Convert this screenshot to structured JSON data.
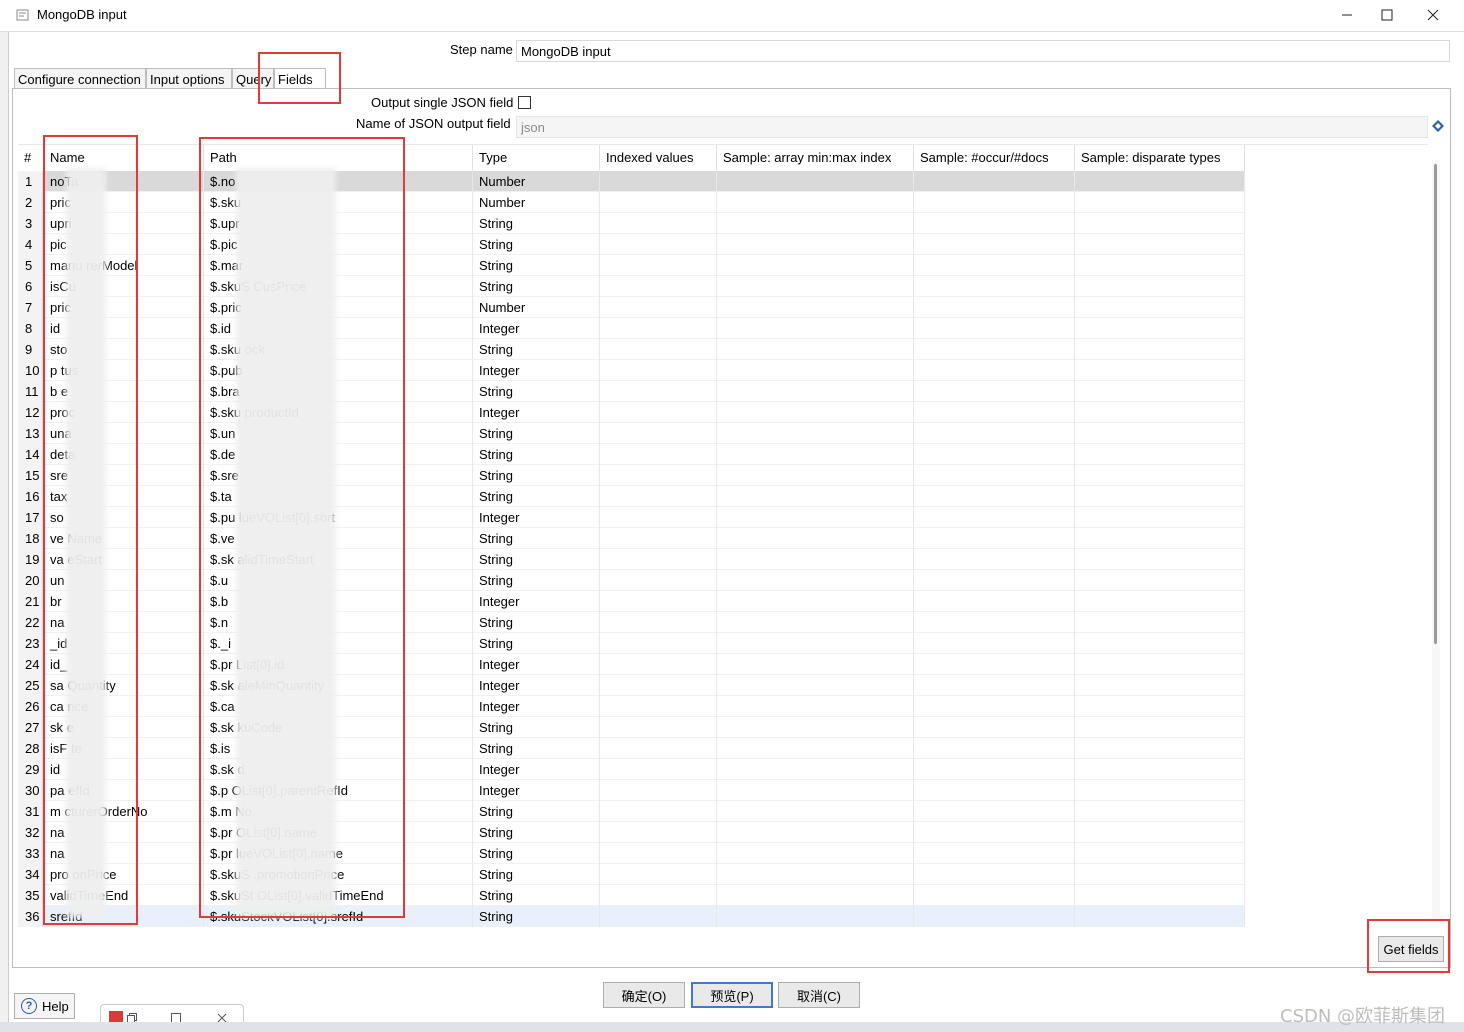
{
  "window": {
    "title": "MongoDB input"
  },
  "step": {
    "label": "Step name",
    "value": "MongoDB input"
  },
  "tabs": [
    {
      "label": "Configure connection"
    },
    {
      "label": "Input options"
    },
    {
      "label": "Query"
    },
    {
      "label": "Fields"
    }
  ],
  "fields_tab": {
    "output_single_json_label": "Output single JSON field",
    "json_output_name_label": "Name of JSON output field",
    "json_output_name_placeholder": "json"
  },
  "table": {
    "headers": [
      "#",
      "Name",
      "Path",
      "Type",
      "Indexed values",
      "Sample: array min:max index",
      "Sample: #occur/#docs",
      "Sample: disparate types"
    ],
    "rows": [
      {
        "n": "1",
        "name": "noTa",
        "path": "$.no",
        "type": "Number"
      },
      {
        "n": "2",
        "name": "pric",
        "path": "$.sku",
        "type": "Number"
      },
      {
        "n": "3",
        "name": "upri",
        "path": "$.upr",
        "type": "String"
      },
      {
        "n": "4",
        "name": "pic",
        "path": "$.pic",
        "type": "String"
      },
      {
        "n": "5",
        "name": "manu          rerModel",
        "path": "$.mar",
        "type": "String"
      },
      {
        "n": "6",
        "name": "isCu",
        "path": "$.skuS                     CusPrice",
        "type": "String"
      },
      {
        "n": "7",
        "name": "pric",
        "path": "$.pric",
        "type": "Number"
      },
      {
        "n": "8",
        "name": "id",
        "path": "$.id",
        "type": "Integer"
      },
      {
        "n": "9",
        "name": "sto",
        "path": "$.sku                       ock",
        "type": "String"
      },
      {
        "n": "10",
        "name": "p          tus",
        "path": "$.pub",
        "type": "Integer"
      },
      {
        "n": "11",
        "name": "b           e",
        "path": "$.bra",
        "type": "String"
      },
      {
        "n": "12",
        "name": "proc",
        "path": "$.sku                      productId",
        "type": "Integer"
      },
      {
        "n": "13",
        "name": "una",
        "path": "$.un",
        "type": "String"
      },
      {
        "n": "14",
        "name": "deta",
        "path": "$.de",
        "type": "String"
      },
      {
        "n": "15",
        "name": "sre",
        "path": "$.sre",
        "type": "String"
      },
      {
        "n": "16",
        "name": "tax",
        "path": "$.ta",
        "type": "String"
      },
      {
        "n": "17",
        "name": "so",
        "path": "$.pu                        lueVOList[0].sort",
        "type": "Integer"
      },
      {
        "n": "18",
        "name": "ve         Name",
        "path": "$.ve",
        "type": "String"
      },
      {
        "n": "19",
        "name": "va         eStart",
        "path": "$.sk                        alidTimeStart",
        "type": "String"
      },
      {
        "n": "20",
        "name": "un",
        "path": "$.u",
        "type": "String"
      },
      {
        "n": "21",
        "name": "br",
        "path": "$.b",
        "type": "Integer"
      },
      {
        "n": "22",
        "name": "na",
        "path": "$.n",
        "type": "String"
      },
      {
        "n": "23",
        "name": "_id",
        "path": "$._i",
        "type": "String"
      },
      {
        "n": "24",
        "name": "id_",
        "path": "$.pr                        List[0].id",
        "type": "Integer"
      },
      {
        "n": "25",
        "name": "sa         Quantity",
        "path": "$.sk                        aleMinQuantity",
        "type": "Integer"
      },
      {
        "n": "26",
        "name": "ca         rice",
        "path": "$.ca",
        "type": "Integer"
      },
      {
        "n": "27",
        "name": "sk          e",
        "path": "$.sk                        kuCode",
        "type": "String"
      },
      {
        "n": "28",
        "name": "isF          te",
        "path": "$.is",
        "type": "String"
      },
      {
        "n": "29",
        "name": "id",
        "path": "$.sk                        d",
        "type": "Integer"
      },
      {
        "n": "30",
        "name": "pa         efId",
        "path": "$.p                         OList[0].parentRefId",
        "type": "Integer"
      },
      {
        "n": "31",
        "name": "m        cturerOrderNo",
        "path": "$.m                         No",
        "type": "String"
      },
      {
        "n": "32",
        "name": "na",
        "path": "$.pr                        OList[0].name",
        "type": "String"
      },
      {
        "n": "33",
        "name": "na",
        "path": "$.pr                        lueVOList[0].name",
        "type": "String"
      },
      {
        "n": "34",
        "name": "pro          onPrice",
        "path": "$.skuS                  .promotionPrice",
        "type": "String"
      },
      {
        "n": "35",
        "name": "validTimeEnd",
        "path": "$.skuSt          OList[0].validTimeEnd",
        "type": "String"
      },
      {
        "n": "36",
        "name": "srefId",
        "path": "$.skuStockVOList[0].srefId",
        "type": "String"
      }
    ]
  },
  "buttons": {
    "get_fields": "Get fields",
    "ok": "确定(O)",
    "preview": "预览(P)",
    "cancel": "取消(C)",
    "help": "Help"
  },
  "watermark": "CSDN @欧菲斯集团",
  "colors": {
    "annotation_red": "#e53935",
    "focus_blue": "#3c7bd1",
    "selected_row": "#d9d9d9"
  }
}
